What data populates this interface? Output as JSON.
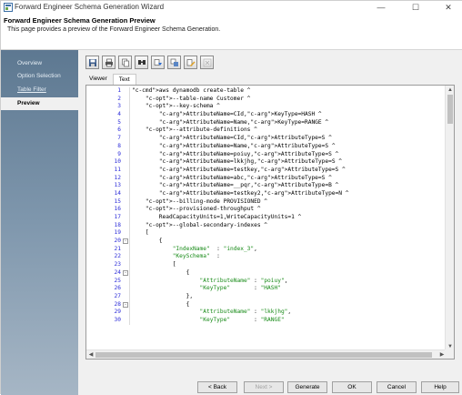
{
  "window": {
    "title": "Forward Engineer Schema Generation Wizard",
    "minimize": "—",
    "maximize": "☐",
    "close": "✕"
  },
  "header": {
    "title": "Forward Engineer Schema Generation Preview",
    "description": "This page provides a preview of the Forward Engineer Schema Generation."
  },
  "sidebar": {
    "items": [
      {
        "label": "Overview"
      },
      {
        "label": "Option Selection"
      },
      {
        "label": "Table Filter"
      },
      {
        "label": "Preview"
      }
    ]
  },
  "toolbar": {
    "icons": [
      "save-icon",
      "print-icon",
      "copy-icon",
      "find-icon",
      "replace-icon",
      "copy-all-icon",
      "edit-icon",
      "refresh-icon"
    ]
  },
  "tabs": [
    {
      "label": "Viewer"
    },
    {
      "label": "Text"
    }
  ],
  "code": {
    "lines": [
      {
        "n": "1",
        "t": "aws dynamodb create-table ^"
      },
      {
        "n": "2",
        "t": "    --table-name Customer ^"
      },
      {
        "n": "3",
        "t": "    --key-schema ^"
      },
      {
        "n": "4",
        "t": "        AttributeName=CId,KeyType=HASH ^"
      },
      {
        "n": "5",
        "t": "        AttributeName=Name,KeyType=RANGE ^"
      },
      {
        "n": "6",
        "t": "    --attribute-definitions ^"
      },
      {
        "n": "7",
        "t": "        AttributeName=CId,AttributeType=S ^"
      },
      {
        "n": "8",
        "t": "        AttributeName=Name,AttributeType=S ^"
      },
      {
        "n": "9",
        "t": "        AttributeName=poiuy,AttributeType=S ^"
      },
      {
        "n": "10",
        "t": "        AttributeName=lkkjhg,AttributeType=S ^"
      },
      {
        "n": "11",
        "t": "        AttributeName=testkey,AttributeType=S ^"
      },
      {
        "n": "12",
        "t": "        AttributeName=abc,AttributeType=S ^"
      },
      {
        "n": "13",
        "t": "        AttributeName=__pqr,AttributeType=B ^"
      },
      {
        "n": "14",
        "t": "        AttributeName=testkey2,AttributeType=N ^"
      },
      {
        "n": "15",
        "t": "    --billing-mode PROVISIONED ^"
      },
      {
        "n": "16",
        "t": "    --provisioned-throughput ^"
      },
      {
        "n": "17",
        "t": "        ReadCapacityUnits=1,WriteCapacityUnits=1 ^"
      },
      {
        "n": "18",
        "t": "    --global-secondary-indexes ^"
      },
      {
        "n": "19",
        "t": "    ["
      },
      {
        "n": "20",
        "t": "        {",
        "fold": "-"
      },
      {
        "n": "21",
        "t": "            \"IndexName\"  : \"index_3\","
      },
      {
        "n": "22",
        "t": "            \"KeySchema\"  :"
      },
      {
        "n": "23",
        "t": "            ["
      },
      {
        "n": "24",
        "t": "                {",
        "fold": "-"
      },
      {
        "n": "25",
        "t": "                    \"AttributeName\" : \"poiuy\","
      },
      {
        "n": "26",
        "t": "                    \"KeyType\"       : \"HASH\""
      },
      {
        "n": "27",
        "t": "                },"
      },
      {
        "n": "28",
        "t": "                {",
        "fold": "-"
      },
      {
        "n": "29",
        "t": "                    \"AttributeName\" : \"lkkjhg\","
      },
      {
        "n": "30",
        "t": "                    \"KeyType\"       : \"RANGE\""
      }
    ]
  },
  "buttons": {
    "back": "< Back",
    "next": "Next >",
    "generate": "Generate",
    "ok": "OK",
    "cancel": "Cancel",
    "help": "Help"
  },
  "colors": {
    "sidebar_top": "#5d7891",
    "sidebar_bottom": "#a6b6c5",
    "line_number": "#2b2bd8",
    "keyword": "#7b1fa2",
    "string": "#168a16"
  }
}
